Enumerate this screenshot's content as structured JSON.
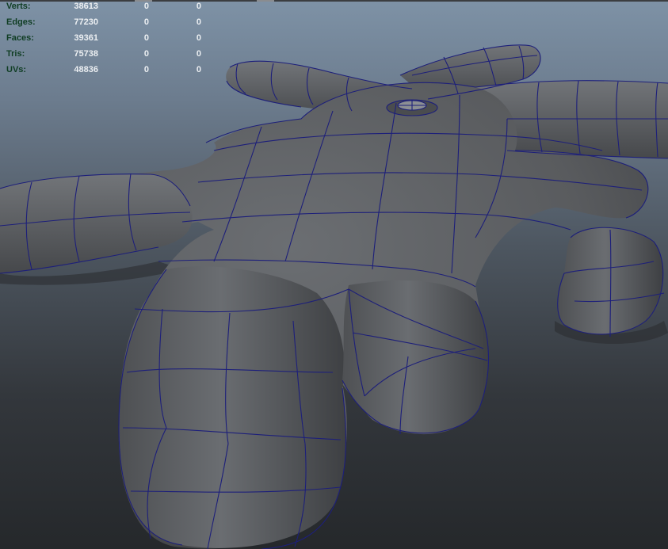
{
  "hud": {
    "stats": [
      {
        "label": "Verts:",
        "total": "38613",
        "selected": "0",
        "triangles": "0"
      },
      {
        "label": "Edges:",
        "total": "77230",
        "selected": "0",
        "triangles": "0"
      },
      {
        "label": "Faces:",
        "total": "39361",
        "selected": "0",
        "triangles": "0"
      },
      {
        "label": "Tris:",
        "total": "75738",
        "selected": "0",
        "triangles": "0"
      },
      {
        "label": "UVs:",
        "total": "48836",
        "selected": "0",
        "triangles": "0"
      }
    ]
  },
  "colors": {
    "background_top": "#7e92a6",
    "background_bottom": "#25282b",
    "mesh_fill": "#585a5d",
    "wireframe": "#1d1f7a",
    "hud_label": "#0f3d23",
    "hud_value": "#eceff2"
  },
  "viewport": {
    "object": "3d-mesh-with-wireframe-overlay"
  }
}
